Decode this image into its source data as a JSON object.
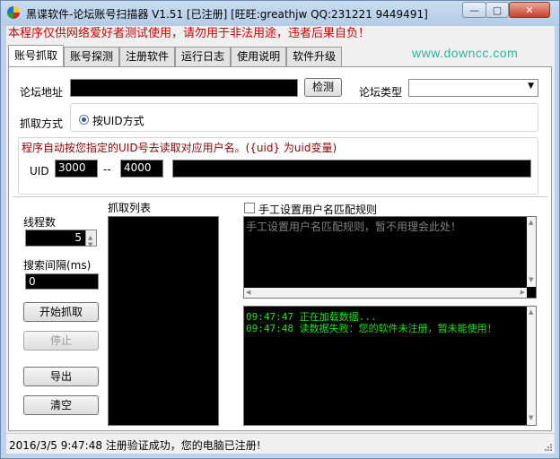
{
  "window": {
    "title": "黑谍软件-论坛账号扫描器 V1.51 [已注册] [旺旺:greathjw QQ:231221 9449491]",
    "minimize": "—",
    "maximize": "▢",
    "close": "✕"
  },
  "warning": "本程序仅供网络爱好者测试使用，请勿用于非法用途，违者后果自负！",
  "brand": "www.downcc.com",
  "tabs": [
    "账号抓取",
    "账号探测",
    "注册软件",
    "运行日志",
    "使用说明",
    "软件升级"
  ],
  "form": {
    "forum_url_label": "论坛地址",
    "forum_url_value": "",
    "detect_button": "检测",
    "forum_type_label": "论坛类型",
    "forum_type_value": "",
    "grab_mode_label": "抓取方式",
    "grab_mode_option": "按UID方式",
    "hint": "程序自动按您指定的UID号去读取对应用户名。({uid} 为uid变量)",
    "uid_label": "UID",
    "uid_from": "3000",
    "uid_sep": "--",
    "uid_to": "4000",
    "uid_extra": ""
  },
  "left": {
    "threads_label": "线程数",
    "threads_value": "5",
    "interval_label": "搜索间隔(ms)",
    "interval_value": "0",
    "start_button": "开始抓取",
    "stop_button": "停止",
    "export_button": "导出",
    "clear_button": "清空"
  },
  "list": {
    "title": "抓取列表"
  },
  "rules": {
    "checkbox_label": "手工设置用户名匹配规则",
    "text": "手工设置用户名匹配规则，暂不用理会此处！"
  },
  "log": {
    "lines": [
      "09:47:47 正在加载数据...",
      "09:47:48 读数据失败：您的软件未注册，暂未能使用！"
    ]
  },
  "status": "2016/3/5 9:47:48  注册验证成功，您的电脑已注册!",
  "colors": {
    "warning": "#cc0000",
    "brand": "#2fb39a",
    "log_text": "#19e619",
    "hint_text": "#8b0000"
  }
}
